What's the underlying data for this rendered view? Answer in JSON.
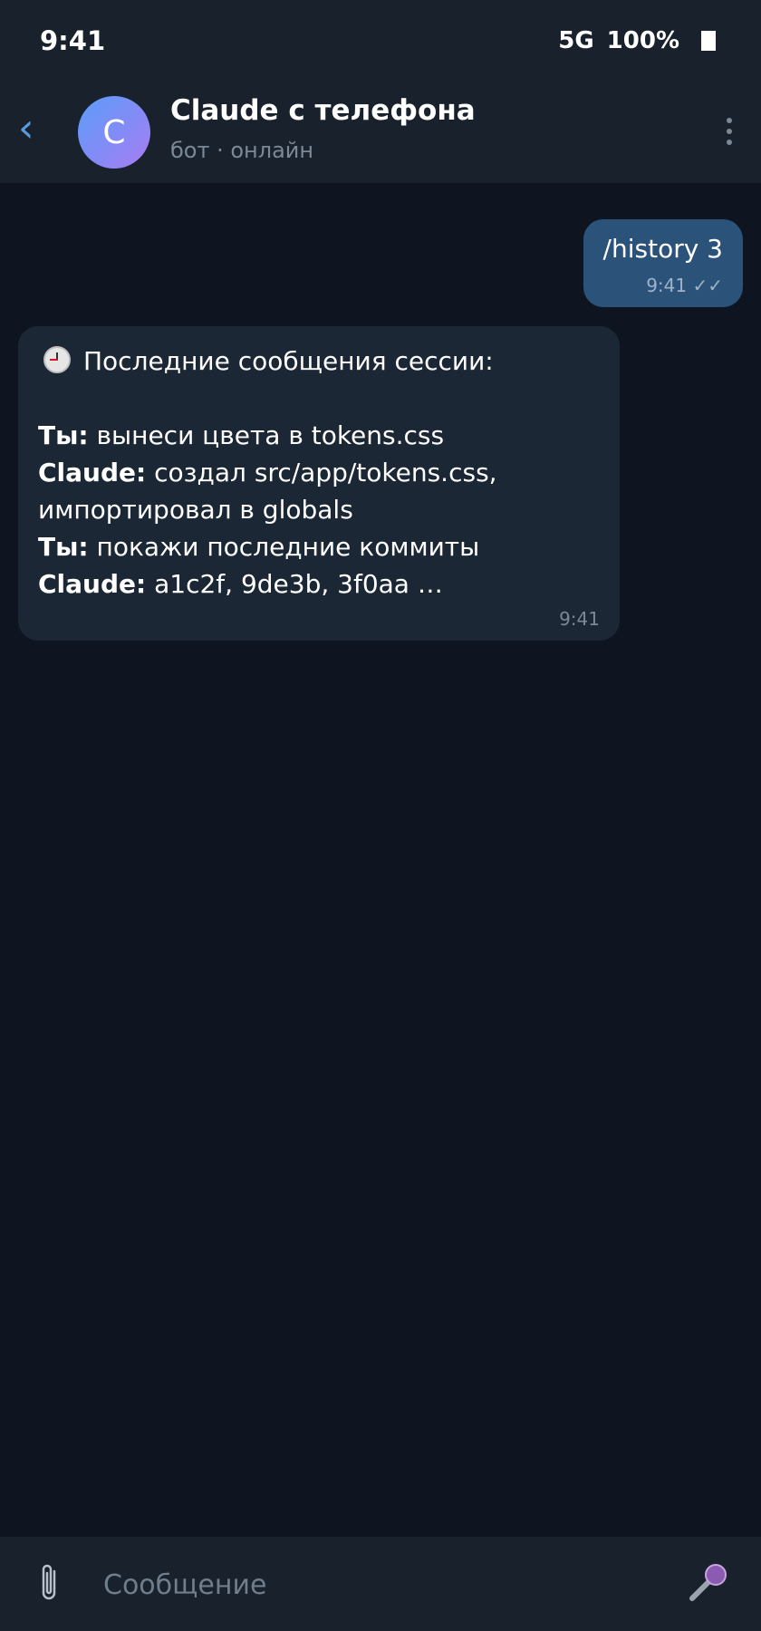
{
  "status": {
    "time": "9:41",
    "network": "5G",
    "battery": "100%"
  },
  "header": {
    "back_icon": "chevron-left-icon",
    "avatar_letter": "C",
    "title": "Claude с телефона",
    "subtitle": "бот · онлайн",
    "menu_icon": "more-vertical-icon"
  },
  "messages": {
    "outgoing": {
      "text": "/history 3",
      "time": "9:41",
      "status": "✓✓"
    },
    "incoming": {
      "heading": "Последние сообщения сессии:",
      "lines": [
        {
          "speaker": "Ты:",
          "text": " вынеси цвета в tokens.css"
        },
        {
          "speaker": "Claude:",
          "text": " создал src/app/tokens.css, импортировал в globals"
        },
        {
          "speaker": "Ты:",
          "text": " покажи последние коммиты"
        },
        {
          "speaker": "Claude:",
          "text": " a1c2f, 9de3b, 3f0aa …"
        }
      ],
      "time": "9:41"
    }
  },
  "composer": {
    "placeholder": "Сообщение",
    "attach_icon": "paperclip-icon",
    "mic_icon": "microphone-icon"
  },
  "colors": {
    "background": "#0f1520",
    "bar": "#18212c",
    "outgoing_bubble": "#2b5278",
    "incoming_bubble": "#1b2734",
    "accent": "#5a9be0"
  }
}
